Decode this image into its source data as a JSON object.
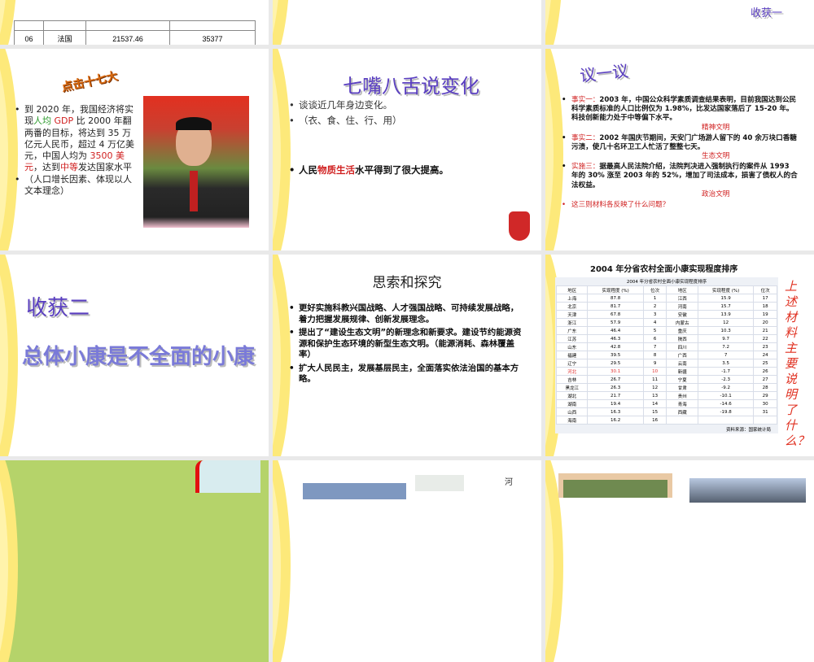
{
  "slide1": {
    "row": [
      "06",
      "法国",
      "21537.46",
      "35377"
    ]
  },
  "slide3": {
    "label": "收获一"
  },
  "slide4": {
    "title": "点击十七大",
    "bullets": [
      {
        "parts": [
          {
            "t": "到 2020 年，我国经济将实现"
          },
          {
            "t": "人均",
            "c": "green"
          },
          {
            "t": " GDP",
            "c": "red"
          },
          {
            "t": " 比 2000 年翻两番的目标，将达到 35 万亿元人民币，超过 4 万亿美元，中国人均为 "
          },
          {
            "t": "3500 美元",
            "c": "red"
          },
          {
            "t": "，达到"
          },
          {
            "t": "中等",
            "c": "red"
          },
          {
            "t": "发达国家水平"
          }
        ]
      },
      {
        "parts": [
          {
            "t": "（人口增长因素、体现以人文本理念）"
          }
        ]
      }
    ]
  },
  "slide5": {
    "title": "七嘴八舌说变化",
    "b1": "谈谈近几年身边变化。",
    "b2": "（衣、食、住、行、用）",
    "b3a": "人民",
    "b3b": "物质生活",
    "b3c": "水平得到了很大提高。"
  },
  "slide6": {
    "title": "议一议",
    "items": [
      {
        "lead": "事实一：",
        "text": "2003 年，中国公众科学素质调查结果表明，目前我国达到公民科学素质标准的人口比例仅为 1.98%，比发达国家落后了 15-20 年。科技创新能力处于中等偏下水平。",
        "tag": "精神文明"
      },
      {
        "lead": "事实二：",
        "text": "2002 年国庆节期间，天安门广场游人留下的 40 余万块口香糖污渍，使几十名环卫工人忙活了整整七天。",
        "tag": "生态文明"
      },
      {
        "lead": "实施三：",
        "text": "据最高人民法院介绍，法院判决进入强制执行的案件从 1993 年的 30% 涨至 2003 年的 52%，增加了司法成本，损害了债权人的合法权益。",
        "tag": "政治文明"
      }
    ],
    "question": "这三则材料各反映了什么问题？"
  },
  "slide7": {
    "title": "收获二",
    "subtitle": "总体小康是不全面的小康"
  },
  "slide8": {
    "title": "思索和探究",
    "bullets": [
      "更好实施科教兴国战略、人才强国战略、可持续发展战略，着力把握发展规律、创新发展理念。",
      "提出了“建设生态文明”的新理念和新要求。建设节约能源资源和保护生态环境的新型生态文明。（能源消耗、森林覆盖率）",
      "扩大人民民主，发展基层民主，全面落实依法治国的基本方略。"
    ]
  },
  "slide9": {
    "title": "2004 年分省农村全面小康实现程度排序",
    "table_title": "2004 年分省农村全面小康实现程度排序",
    "headers": [
      "地区",
      "实现程度 (%)",
      "位次",
      "地区",
      "实现程度 (%)",
      "位次"
    ],
    "rows": [
      [
        "上海",
        "87.8",
        "1",
        "江西",
        "15.9",
        "17"
      ],
      [
        "北京",
        "81.7",
        "2",
        "河南",
        "15.7",
        "18"
      ],
      [
        "天津",
        "67.8",
        "3",
        "安徽",
        "13.9",
        "19"
      ],
      [
        "浙江",
        "57.9",
        "4",
        "内蒙古",
        "12",
        "20"
      ],
      [
        "广东",
        "46.4",
        "5",
        "重庆",
        "10.3",
        "21"
      ],
      [
        "江苏",
        "46.3",
        "6",
        "陕西",
        "9.7",
        "22"
      ],
      [
        "山东",
        "42.8",
        "7",
        "四川",
        "7.2",
        "23"
      ],
      [
        "福建",
        "39.5",
        "8",
        "广西",
        "7",
        "24"
      ],
      [
        "辽宁",
        "29.5",
        "9",
        "云南",
        "3.5",
        "25"
      ],
      [
        "河北",
        "30.1",
        "10",
        "新疆",
        "-1.7",
        "26"
      ],
      [
        "吉林",
        "26.7",
        "11",
        "宁夏",
        "-2.3",
        "27"
      ],
      [
        "黑龙江",
        "26.3",
        "12",
        "甘肃",
        "-9.2",
        "28"
      ],
      [
        "湖北",
        "21.7",
        "13",
        "贵州",
        "-10.1",
        "29"
      ],
      [
        "湖南",
        "19.4",
        "14",
        "青海",
        "-14.6",
        "30"
      ],
      [
        "山西",
        "16.3",
        "15",
        "西藏",
        "-19.8",
        "31"
      ],
      [
        "海南",
        "16.2",
        "16",
        "",
        "",
        ""
      ]
    ],
    "source": "资料来源：国家统计局",
    "side_note": "上述材料主要说明了什么？"
  },
  "slide11": {
    "vertical": "河"
  }
}
